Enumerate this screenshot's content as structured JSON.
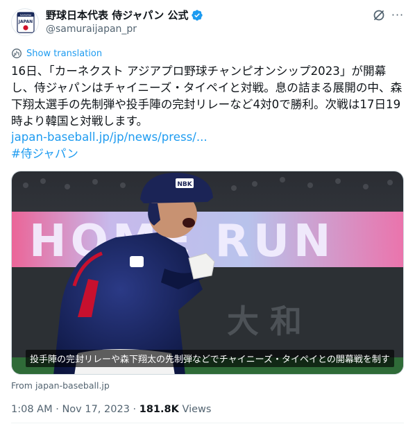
{
  "account": {
    "display_name": "野球日本代表 侍ジャパン 公式",
    "handle": "@samuraijapan_pr",
    "avatar_text_top": "SAMURAI",
    "avatar_text_main": "JAPAN"
  },
  "actions": {
    "more_label": "···"
  },
  "translation": {
    "label": "Show translation"
  },
  "tweet": {
    "text": "16日、「カーネクスト アジアプロ野球チャンピオンシップ2023」が開幕し、侍ジャパンはチャイニーズ・タイペイと対戦。息の詰まる展開の中、森下翔太選手の先制弾や投手陣の完封リレーなど4対0で勝利。次戦は17日19時より韓国と対戦します。",
    "link": "japan-baseball.jp/jp/news/press/...",
    "hashtag": "#侍ジャパン"
  },
  "media": {
    "banner_text": "HOME RUN",
    "helmet_badge": "NBK",
    "stadium_text": "大 和",
    "caption": "投手陣の完封リレーや森下翔太の先制弾などでチャイニーズ・タイペイとの開幕戦を制す"
  },
  "source": {
    "label": "From japan-baseball.jp"
  },
  "meta": {
    "time": "1:08 AM",
    "sep1": " · ",
    "date": "Nov 17, 2023",
    "sep2": " · ",
    "views": "181.8K",
    "views_label": " Views"
  },
  "colors": {
    "link": "#1d9bf0",
    "verified": "#1d9bf0",
    "secondary_text": "#536471",
    "banner": "#e8e0ff"
  }
}
